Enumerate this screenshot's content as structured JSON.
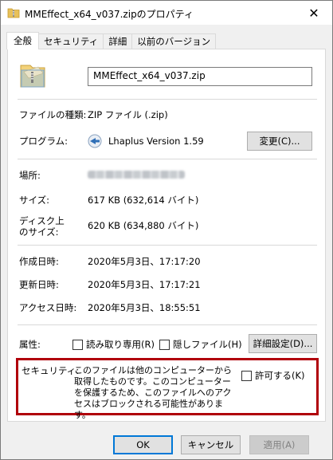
{
  "window": {
    "title": "MMEffect_x64_v037.zipのプロパティ",
    "close_glyph": "✕"
  },
  "tabs": [
    {
      "label": "全般",
      "active": true
    },
    {
      "label": "セキュリティ",
      "active": false
    },
    {
      "label": "詳細",
      "active": false
    },
    {
      "label": "以前のバージョン",
      "active": false
    }
  ],
  "general": {
    "file_name": "MMEffect_x64_v037.zip",
    "type_label": "ファイルの種類:",
    "type_value": "ZIP ファイル (.zip)",
    "program_label": "プログラム:",
    "program_value": "Lhaplus Version 1.59",
    "change_button": "変更(C)...",
    "location_label": "場所:",
    "size_label": "サイズ:",
    "size_value": "617 KB (632,614 バイト)",
    "disk_size_label_1": "ディスク上",
    "disk_size_label_2": "のサイズ:",
    "disk_size_value": "620 KB (634,880 バイト)",
    "created_label": "作成日時:",
    "created_value": "2020年5月3日、17:17:20",
    "modified_label": "更新日時:",
    "modified_value": "2020年5月3日、17:17:21",
    "accessed_label": "アクセス日時:",
    "accessed_value": "2020年5月3日、18:55:51",
    "attributes_label": "属性:",
    "readonly_label": "読み取り専用(R)",
    "readonly_checked": false,
    "hidden_label": "隠しファイル(H)",
    "hidden_checked": false,
    "advanced_button": "詳細設定(D)..."
  },
  "security": {
    "label": "セキュリティ:",
    "message": "このファイルは他のコンピューターから取得したものです。このコンピューターを保護するため、このファイルへのアクセスはブロックされる可能性があります。",
    "allow_label": "許可する(K)",
    "allow_checked": false,
    "highlight_color": "#b0000a"
  },
  "buttons": {
    "ok": "OK",
    "cancel": "キャンセル",
    "apply": "適用(A)"
  },
  "icons": {
    "title": "zip-folder-icon",
    "file": "zip-folder-icon",
    "program": "lhaplus-app-icon"
  }
}
